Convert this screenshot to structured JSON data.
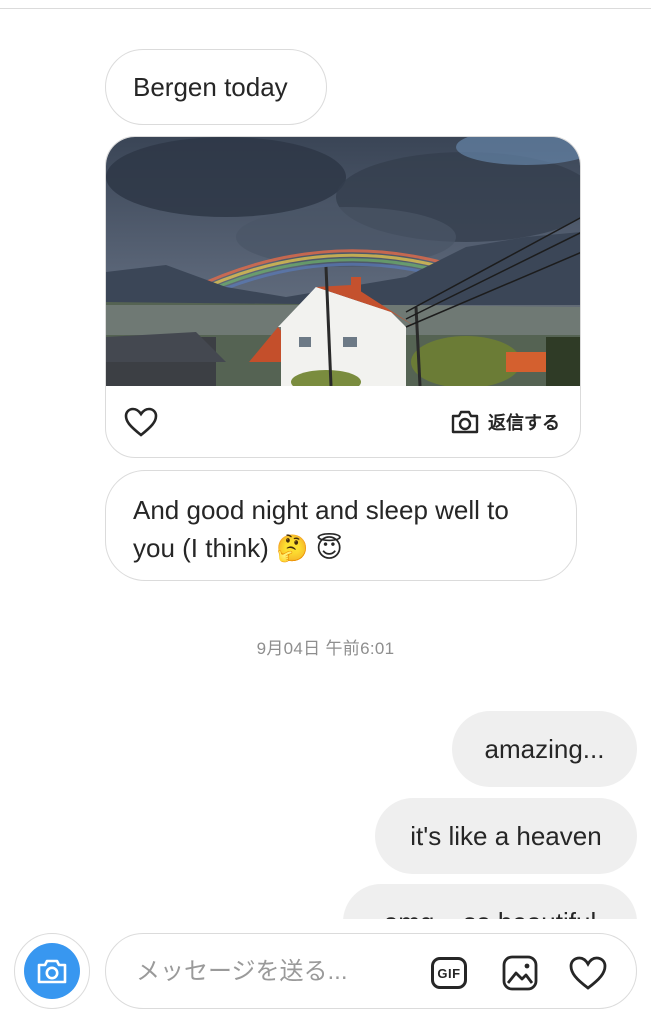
{
  "thread": {
    "incoming": [
      {
        "text": "Bergen today"
      },
      {
        "text": "And good night and sleep well to you (I think) 🤔 😇"
      }
    ],
    "photo_card": {
      "icon_like": "heart-outline-icon",
      "icon_reply": "camera-outline-icon",
      "reply_label": "返信する"
    },
    "timestamp": "9月04日 午前6:01",
    "outgoing": [
      {
        "text": "amazing..."
      },
      {
        "text": "it's like a heaven"
      },
      {
        "text": "omg... so beautiful"
      }
    ]
  },
  "composer": {
    "placeholder": "メッセージを送る...",
    "camera_icon": "camera-icon",
    "gif_label": "GIF",
    "gallery_icon": "image-gallery-icon",
    "heart_icon": "heart-icon"
  },
  "colors": {
    "accent": "#3897f0",
    "incoming_border": "#dbdbdb",
    "outgoing_bg": "#efefef",
    "timestamp": "#8e8e8e"
  }
}
